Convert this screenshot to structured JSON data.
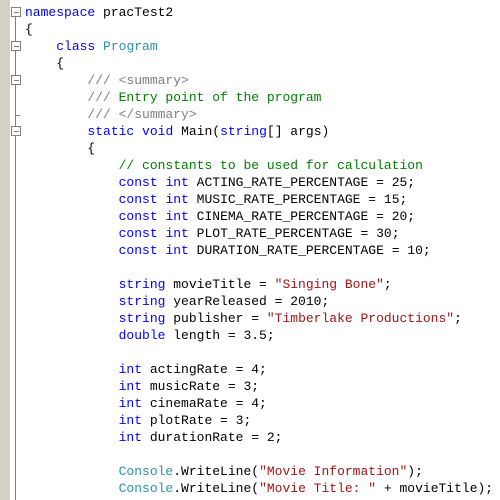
{
  "editor": {
    "lines": [
      [
        {
          "t": "namespace",
          "c": "kw"
        },
        {
          "t": " pracTest2",
          "c": ""
        }
      ],
      [
        {
          "t": "{",
          "c": ""
        }
      ],
      [
        {
          "t": "    ",
          "c": ""
        },
        {
          "t": "class",
          "c": "kw"
        },
        {
          "t": " ",
          "c": ""
        },
        {
          "t": "Program",
          "c": "type"
        }
      ],
      [
        {
          "t": "    {",
          "c": ""
        }
      ],
      [
        {
          "t": "        ",
          "c": ""
        },
        {
          "t": "/// <summary>",
          "c": "xml"
        }
      ],
      [
        {
          "t": "        ",
          "c": ""
        },
        {
          "t": "///",
          "c": "xml"
        },
        {
          "t": " Entry point of the program",
          "c": "cmt"
        }
      ],
      [
        {
          "t": "        ",
          "c": ""
        },
        {
          "t": "/// </summary>",
          "c": "xml"
        }
      ],
      [
        {
          "t": "        ",
          "c": ""
        },
        {
          "t": "static",
          "c": "kw"
        },
        {
          "t": " ",
          "c": ""
        },
        {
          "t": "void",
          "c": "kw"
        },
        {
          "t": " Main(",
          "c": ""
        },
        {
          "t": "string",
          "c": "kw"
        },
        {
          "t": "[] args)",
          "c": ""
        }
      ],
      [
        {
          "t": "        {",
          "c": ""
        }
      ],
      [
        {
          "t": "            ",
          "c": ""
        },
        {
          "t": "// constants to be used for calculation",
          "c": "cmt"
        }
      ],
      [
        {
          "t": "            ",
          "c": ""
        },
        {
          "t": "const",
          "c": "kw"
        },
        {
          "t": " ",
          "c": ""
        },
        {
          "t": "int",
          "c": "kw"
        },
        {
          "t": " ACTING_RATE_PERCENTAGE = 25;",
          "c": ""
        }
      ],
      [
        {
          "t": "            ",
          "c": ""
        },
        {
          "t": "const",
          "c": "kw"
        },
        {
          "t": " ",
          "c": ""
        },
        {
          "t": "int",
          "c": "kw"
        },
        {
          "t": " MUSIC_RATE_PERCENTAGE = 15;",
          "c": ""
        }
      ],
      [
        {
          "t": "            ",
          "c": ""
        },
        {
          "t": "const",
          "c": "kw"
        },
        {
          "t": " ",
          "c": ""
        },
        {
          "t": "int",
          "c": "kw"
        },
        {
          "t": " CINEMA_RATE_PERCENTAGE = 20;",
          "c": ""
        }
      ],
      [
        {
          "t": "            ",
          "c": ""
        },
        {
          "t": "const",
          "c": "kw"
        },
        {
          "t": " ",
          "c": ""
        },
        {
          "t": "int",
          "c": "kw"
        },
        {
          "t": " PLOT_RATE_PERCENTAGE = 30;",
          "c": ""
        }
      ],
      [
        {
          "t": "            ",
          "c": ""
        },
        {
          "t": "const",
          "c": "kw"
        },
        {
          "t": " ",
          "c": ""
        },
        {
          "t": "int",
          "c": "kw"
        },
        {
          "t": " DURATION_RATE_PERCENTAGE = 10;",
          "c": ""
        }
      ],
      [],
      [
        {
          "t": "            ",
          "c": ""
        },
        {
          "t": "string",
          "c": "kw"
        },
        {
          "t": " movieTitle = ",
          "c": ""
        },
        {
          "t": "\"Singing Bone\"",
          "c": "str"
        },
        {
          "t": ";",
          "c": ""
        }
      ],
      [
        {
          "t": "            ",
          "c": ""
        },
        {
          "t": "string",
          "c": "kw"
        },
        {
          "t": " yearReleased = 2010;",
          "c": ""
        }
      ],
      [
        {
          "t": "            ",
          "c": ""
        },
        {
          "t": "string",
          "c": "kw"
        },
        {
          "t": " publisher = ",
          "c": ""
        },
        {
          "t": "\"Timberlake Productions\"",
          "c": "str"
        },
        {
          "t": ";",
          "c": ""
        }
      ],
      [
        {
          "t": "            ",
          "c": ""
        },
        {
          "t": "double",
          "c": "kw"
        },
        {
          "t": " length = 3.5;",
          "c": ""
        }
      ],
      [],
      [
        {
          "t": "            ",
          "c": ""
        },
        {
          "t": "int",
          "c": "kw"
        },
        {
          "t": " actingRate = 4;",
          "c": ""
        }
      ],
      [
        {
          "t": "            ",
          "c": ""
        },
        {
          "t": "int",
          "c": "kw"
        },
        {
          "t": " musicRate = 3;",
          "c": ""
        }
      ],
      [
        {
          "t": "            ",
          "c": ""
        },
        {
          "t": "int",
          "c": "kw"
        },
        {
          "t": " cinemaRate = 4;",
          "c": ""
        }
      ],
      [
        {
          "t": "            ",
          "c": ""
        },
        {
          "t": "int",
          "c": "kw"
        },
        {
          "t": " plotRate = 3;",
          "c": ""
        }
      ],
      [
        {
          "t": "            ",
          "c": ""
        },
        {
          "t": "int",
          "c": "kw"
        },
        {
          "t": " durationRate = 2;",
          "c": ""
        }
      ],
      [],
      [
        {
          "t": "            ",
          "c": ""
        },
        {
          "t": "Console",
          "c": "type"
        },
        {
          "t": ".WriteLine(",
          "c": ""
        },
        {
          "t": "\"Movie Information\"",
          "c": "str"
        },
        {
          "t": ");",
          "c": ""
        }
      ],
      [
        {
          "t": "            ",
          "c": ""
        },
        {
          "t": "Console",
          "c": "type"
        },
        {
          "t": ".WriteLine(",
          "c": ""
        },
        {
          "t": "\"Movie Title: \"",
          "c": "str"
        },
        {
          "t": " + movieTitle);",
          "c": ""
        }
      ]
    ]
  },
  "colors": {
    "keyword": "#0000ff",
    "type": "#2b91af",
    "comment": "#008000",
    "xml_doc": "#808080",
    "string": "#a31515",
    "gutter": "#d4d0c8"
  }
}
